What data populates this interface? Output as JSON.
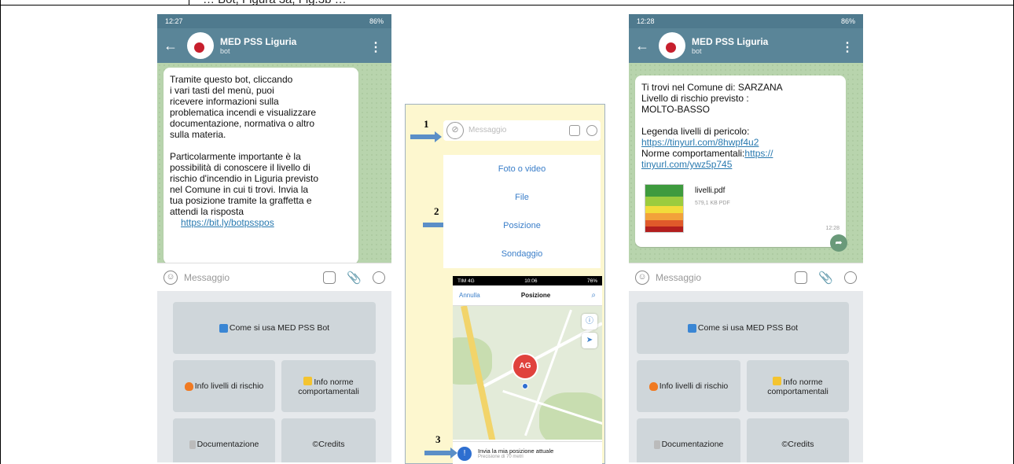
{
  "doc": {
    "top_text": "… Bot, Figura 3a, Fig.3b …"
  },
  "left_phone": {
    "status_time": "12:27",
    "status_right": "86%",
    "chat_title": "MED PSS Liguria",
    "chat_sub": "bot",
    "message": {
      "para1_line1": "Tramite questo bot, cliccando",
      "para1_line2": "i vari tasti del menù, puoi",
      "para1_line3": "ricevere informazioni sulla",
      "para1_line4": "problematica incendi e visualizzare",
      "para1_line5": "documentazione, normativa o altro",
      "para1_line6": "sulla materia.",
      "para2_line1": "Particolarmente importante è la",
      "para2_line2": "possibilità di conoscere il livello di",
      "para2_line3": "rischio d'incendio in Liguria previsto",
      "para2_line4": "nel Comune in cui ti trovi. Invia la",
      "para2_line5": "tua posizione tramite la graffetta e",
      "para2_line6": "attendi la risposta",
      "link": "https://bit.ly/botpsspos"
    },
    "input_placeholder": "Messaggio"
  },
  "keyboard": {
    "btn_how": "Come si usa MED PSS Bot",
    "btn_levels": "Info livelli di rischio",
    "btn_norms_l1": "Info norme",
    "btn_norms_l2": "comportamentali",
    "btn_docs": "Documentazione",
    "btn_credits": "©Credits"
  },
  "middle": {
    "step1": "1",
    "step2": "2",
    "step3": "3",
    "msg_placeholder": "Messaggio",
    "menu": [
      "Foto o video",
      "File",
      "Posizione",
      "Sondaggio"
    ],
    "map_status_left": "TIM 4G",
    "map_status_time": "10:06",
    "map_status_right": "76%",
    "map_cancel": "Annulla",
    "map_title": "Posizione",
    "pin_label": "AG",
    "send_label": "Invia la mia posizione attuale",
    "send_sub": "Precisione di 70 metri"
  },
  "right_phone": {
    "status_time": "12:28",
    "status_right": "86%",
    "chat_title": "MED PSS Liguria",
    "chat_sub": "bot",
    "line1": "Ti trovi nel Comune di: SARZANA",
    "line2": "Livello di rischio previsto :",
    "line3": "MOLTO-BASSO",
    "line4": "Legenda livelli di pericolo:",
    "link1": "https://tinyurl.com/8hwpf4u2",
    "line5_prefix": "Norme comportamentali:",
    "link2a": "https://",
    "link2b": "tinyurl.com/ywz5p745",
    "pdf_name": "livelli.pdf",
    "pdf_size": "579,1 KB PDF",
    "msg_time": "12:28",
    "input_placeholder": "Messaggio"
  },
  "colors": {
    "header": "#5a8598",
    "chat_bg": "#b8d4ad",
    "keyboard_btn": "#cfd6da",
    "mid_bg": "#fdf7cf",
    "arrow": "#5b8fc7",
    "link": "#2a7ab0"
  }
}
